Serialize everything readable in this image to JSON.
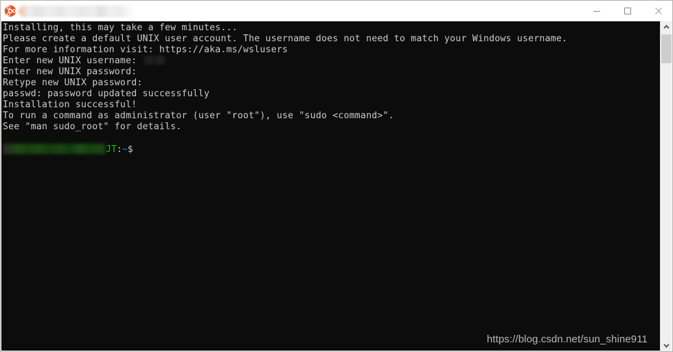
{
  "window": {
    "app_icon": "ubuntu-logo-icon",
    "title_redacted": true,
    "title": "",
    "controls": {
      "minimize": "minimize-icon",
      "maximize": "maximize-icon",
      "close": "close-icon"
    }
  },
  "terminal": {
    "background_color": "#0c0c0c",
    "foreground_color": "#cccccc",
    "lines": [
      "Installing, this may take a few minutes...",
      "Please create a default UNIX user account. The username does not need to match your Windows username.",
      "For more information visit: https://aka.ms/wslusers",
      "Enter new UNIX username: ",
      "Enter new UNIX password:",
      "Retype new UNIX password:",
      "passwd: password updated successfully",
      "Installation successful!",
      "To run a command as administrator (user \"root\"), use \"sudo <command>\".",
      "See \"man sudo_root\" for details."
    ],
    "username_redacted": true,
    "prompt": {
      "user_host_redacted": true,
      "user_host_visible_tail": "JT",
      "separator": ":",
      "path": "~",
      "symbol": "$",
      "color_user_host": "#16c60c",
      "color_path": "#3b78ff",
      "color_symbol": "#cccccc"
    }
  },
  "watermark": {
    "text": "https://blog.csdn.net/sun_shine911"
  },
  "scrollbar": {
    "up_arrow": "chevron-up-icon",
    "down_arrow": "chevron-down-icon",
    "thumb": "scrollbar-thumb"
  }
}
